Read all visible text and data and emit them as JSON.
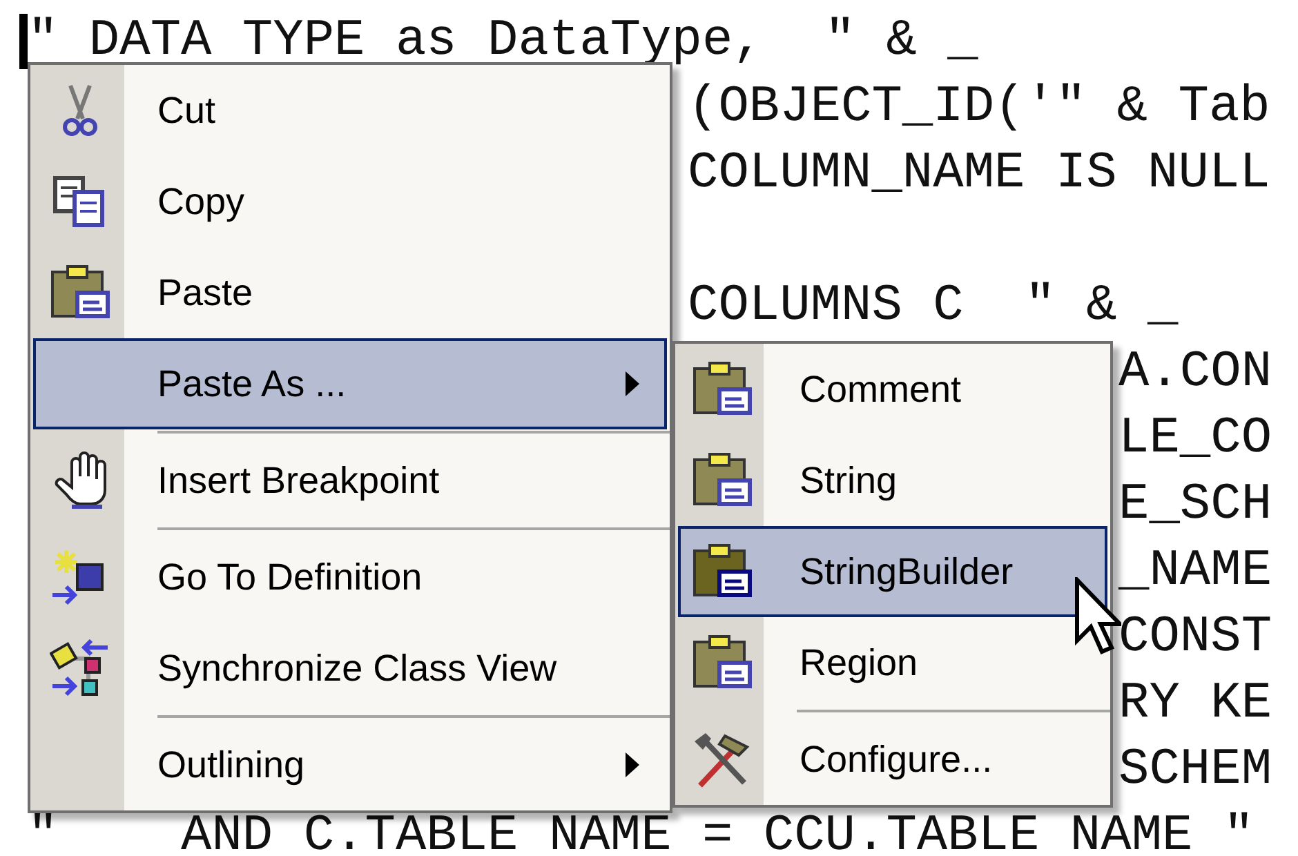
{
  "code_lines": [
    {
      "text": "\" DATA TYPE as DataType,  \" & _",
      "caret": true
    },
    {
      "text": "(OBJECT_ID('\" & Tab"
    },
    {
      "text": "COLUMN_NAME IS NULL"
    },
    {
      "text": "COLUMNS C  \" & _",
      "blank_line_before": true
    },
    {
      "text": "A.CON"
    },
    {
      "text": "LE_CO"
    },
    {
      "text": "E_SCH"
    },
    {
      "text": "_NAME"
    },
    {
      "text": "CONST"
    },
    {
      "text": "RY KE"
    },
    {
      "text": "SCHEM"
    },
    {
      "text": "\"    AND C.TABLE NAME = CCU.TABLE NAME \""
    }
  ],
  "context_menu": {
    "items": [
      {
        "kind": "item",
        "label": "Cut",
        "selected": false,
        "submenu": false
      },
      {
        "kind": "item",
        "label": "Copy",
        "selected": false,
        "submenu": false
      },
      {
        "kind": "item",
        "label": "Paste",
        "selected": false,
        "submenu": false
      },
      {
        "kind": "item",
        "label": "Paste As ...",
        "selected": true,
        "submenu": true
      },
      {
        "kind": "separator"
      },
      {
        "kind": "item",
        "label": "Insert Breakpoint",
        "selected": false,
        "submenu": false
      },
      {
        "kind": "separator"
      },
      {
        "kind": "item",
        "label": "Go To Definition",
        "selected": false,
        "submenu": false
      },
      {
        "kind": "item",
        "label": "Synchronize Class View",
        "selected": false,
        "submenu": false
      },
      {
        "kind": "separator"
      },
      {
        "kind": "item",
        "label": "Outlining",
        "selected": false,
        "submenu": true
      }
    ]
  },
  "submenu": {
    "items": [
      {
        "kind": "item",
        "label": "Comment",
        "selected": false
      },
      {
        "kind": "item",
        "label": "String",
        "selected": false
      },
      {
        "kind": "item",
        "label": "StringBuilder",
        "selected": true
      },
      {
        "kind": "item",
        "label": "Region",
        "selected": false
      },
      {
        "kind": "separator"
      },
      {
        "kind": "item",
        "label": "Configure...",
        "selected": false
      }
    ]
  }
}
